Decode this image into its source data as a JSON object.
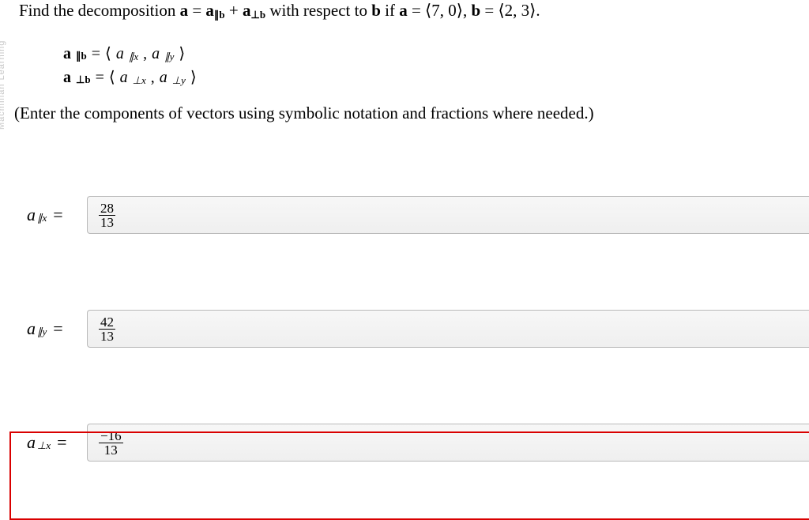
{
  "watermark": "Macmillan Learning",
  "problem": {
    "prefix": "Find the decomposition ",
    "a": "a",
    "eq1": " = ",
    "apar": "a",
    "parsub": "∥b",
    "plus": " + ",
    "aperp": "a",
    "perpsub": "⊥b",
    "mid": " with respect to ",
    "b": "b",
    "if": " if ",
    "a2": "a",
    "eq2": " = ⟨7, 0⟩, ",
    "b2": "b",
    "eq3": " = ⟨2, 3⟩."
  },
  "defs": {
    "row1_lhs_a": "a",
    "row1_lhs_sub": "∥b",
    "row1_eq": " = ",
    "row1_open": "⟨",
    "row1_c1_a": "a",
    "row1_c1_sub": "∥x",
    "row1_comma": ", ",
    "row1_c2_a": "a",
    "row1_c2_sub": "∥y",
    "row1_close": "⟩",
    "row2_lhs_a": "a",
    "row2_lhs_sub": "⊥b",
    "row2_eq": " = ",
    "row2_open": "⟨",
    "row2_c1_a": "a",
    "row2_c1_sub": "⊥x",
    "row2_comma": ", ",
    "row2_c2_a": "a",
    "row2_c2_sub": "⊥y",
    "row2_close": "⟩"
  },
  "instruction": "(Enter the components of vectors using symbolic notation and fractions where needed.)",
  "answers": {
    "r1": {
      "var": "a",
      "sub": "∥x",
      "eq": "=",
      "num": "28",
      "den": "13"
    },
    "r2": {
      "var": "a",
      "sub": "∥y",
      "eq": "=",
      "num": "42",
      "den": "13"
    },
    "r3": {
      "var": "a",
      "sub": "⊥x",
      "eq": "=",
      "num": "−16",
      "den": "13"
    }
  }
}
